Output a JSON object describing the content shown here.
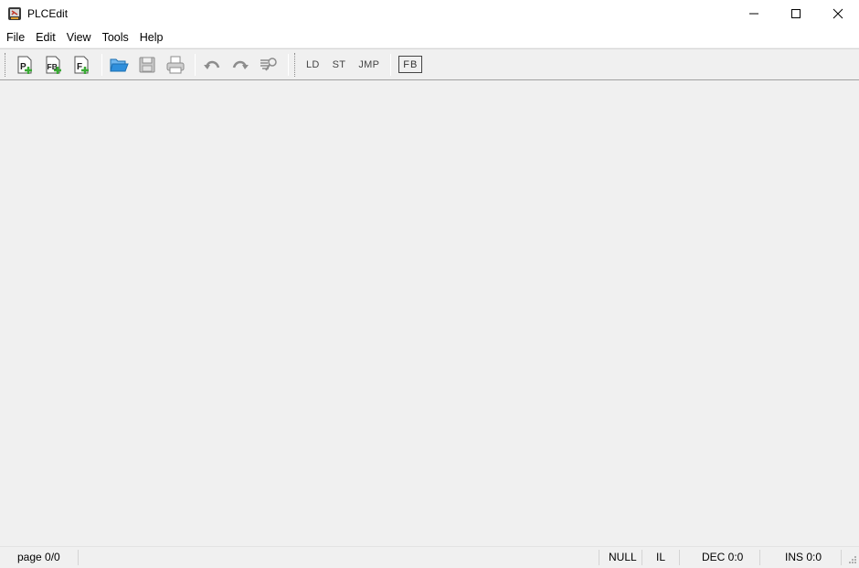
{
  "window": {
    "title": "PLCEdit",
    "controls": [
      "minimize-icon",
      "maximize-icon",
      "close-icon"
    ]
  },
  "menu": {
    "items": [
      {
        "label": "File"
      },
      {
        "label": "Edit"
      },
      {
        "label": "View"
      },
      {
        "label": "Tools"
      },
      {
        "label": "Help"
      }
    ]
  },
  "toolbar": {
    "icons": {
      "new_program": {
        "icon": "new-program-icon",
        "letter": "P"
      },
      "new_function_block": {
        "icon": "new-function-block-icon",
        "letter": "FB"
      },
      "new_function": {
        "icon": "new-function-icon",
        "letter": "F"
      },
      "open": {
        "icon": "open-folder-icon"
      },
      "save": {
        "icon": "save-icon"
      },
      "print": {
        "icon": "print-icon"
      },
      "undo": {
        "icon": "undo-icon"
      },
      "redo": {
        "icon": "redo-icon"
      },
      "find": {
        "icon": "find-replace-icon"
      }
    },
    "text_buttons": {
      "ld": "LD",
      "st": "ST",
      "jmp": "JMP",
      "fb": "FB"
    }
  },
  "status": {
    "page": "page 0/0",
    "null": "NULL",
    "lang": "IL",
    "dec": "DEC 0:0",
    "ins": "INS 0:0"
  },
  "colors": {
    "plus_green": "#3aa935",
    "folder_blue": "#2f8fdc",
    "icon_gray": "#8c8c8c"
  }
}
